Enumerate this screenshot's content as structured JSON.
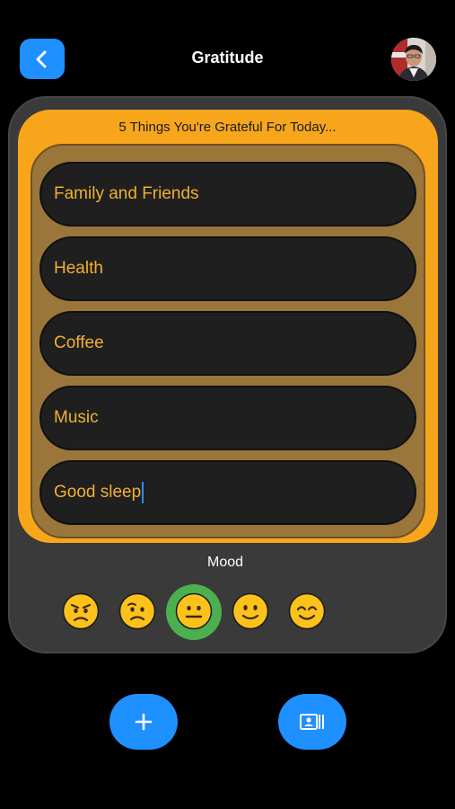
{
  "header": {
    "title": "Gratitude",
    "back_icon": "chevron-left-icon",
    "avatar": "user-avatar"
  },
  "gratitude": {
    "heading": "5 Things You're Grateful For Today...",
    "entries": [
      {
        "value": "Family and Friends"
      },
      {
        "value": "Health"
      },
      {
        "value": "Coffee"
      },
      {
        "value": "Music"
      },
      {
        "value": "Good sleep",
        "focused": true
      }
    ]
  },
  "mood": {
    "label": "Mood",
    "options": [
      {
        "icon": "angry-face-icon"
      },
      {
        "icon": "confused-face-icon"
      },
      {
        "icon": "neutral-face-icon",
        "selected": true
      },
      {
        "icon": "slight-smile-face-icon"
      },
      {
        "icon": "smiling-face-icon"
      }
    ]
  },
  "actions": {
    "add_icon": "plus-icon",
    "gallery_icon": "contact-card-icon"
  },
  "colors": {
    "accent": "#1e90ff",
    "panel": "#f7a61c",
    "entry_text": "#f0b030",
    "selected_ring": "#4caf50"
  }
}
